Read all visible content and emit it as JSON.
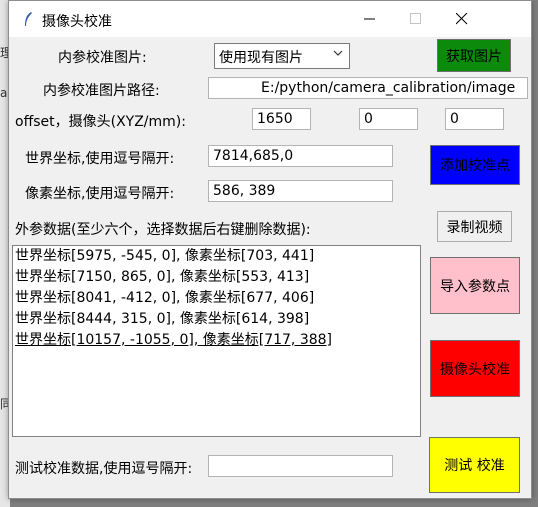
{
  "window": {
    "title": "摄像头校准",
    "buttons": {
      "minimize": "—",
      "maximize": "☐",
      "close": "✕"
    }
  },
  "form": {
    "intrinsic_image_label": "内参校准图片:",
    "intrinsic_image_select": {
      "value": "使用现有图片"
    },
    "get_image_button": "获取图片",
    "intrinsic_path_label": "内参校准图片路径:",
    "intrinsic_path_value": "E:/python/camera_calibration/image",
    "offset_label": "offset，摄像头(XYZ/mm):",
    "offset": {
      "x": "1650",
      "y": "0",
      "z": "0"
    },
    "world_coord_label": "世界坐标,使用逗号隔开:",
    "world_coord_value": "7814,685,0",
    "add_point_button": "添加校准点",
    "pixel_coord_label": "像素坐标,使用逗号隔开:",
    "pixel_coord_value": "586, 389",
    "extrinsic_data_label": "外参数据(至少六个，选择数据后右键删除数据):",
    "record_video_button": "录制视频",
    "import_points_button": "导入参数点",
    "calibrate_button": "摄像头校准",
    "test_label": "测试校准数据,使用逗号隔开:",
    "test_value": "",
    "test_button": "测试  校准"
  },
  "extrinsic_list": [
    "世界坐标[5975, -545, 0],  像素坐标[703, 441]",
    "世界坐标[7150, 865, 0],  像素坐标[553, 413]",
    "世界坐标[8041, -412, 0],  像素坐标[677, 406]",
    "世界坐标[8444, 315, 0],  像素坐标[614, 398]",
    "世界坐标[10157, -1055, 0],  像素坐标[717, 388]"
  ],
  "colors": {
    "get_image_button": "#0b8a0b",
    "add_point_button": "#0000ff",
    "import_points_button": "#ffc0cb",
    "calibrate_button": "#ff0000",
    "test_button": "#ffff00"
  }
}
